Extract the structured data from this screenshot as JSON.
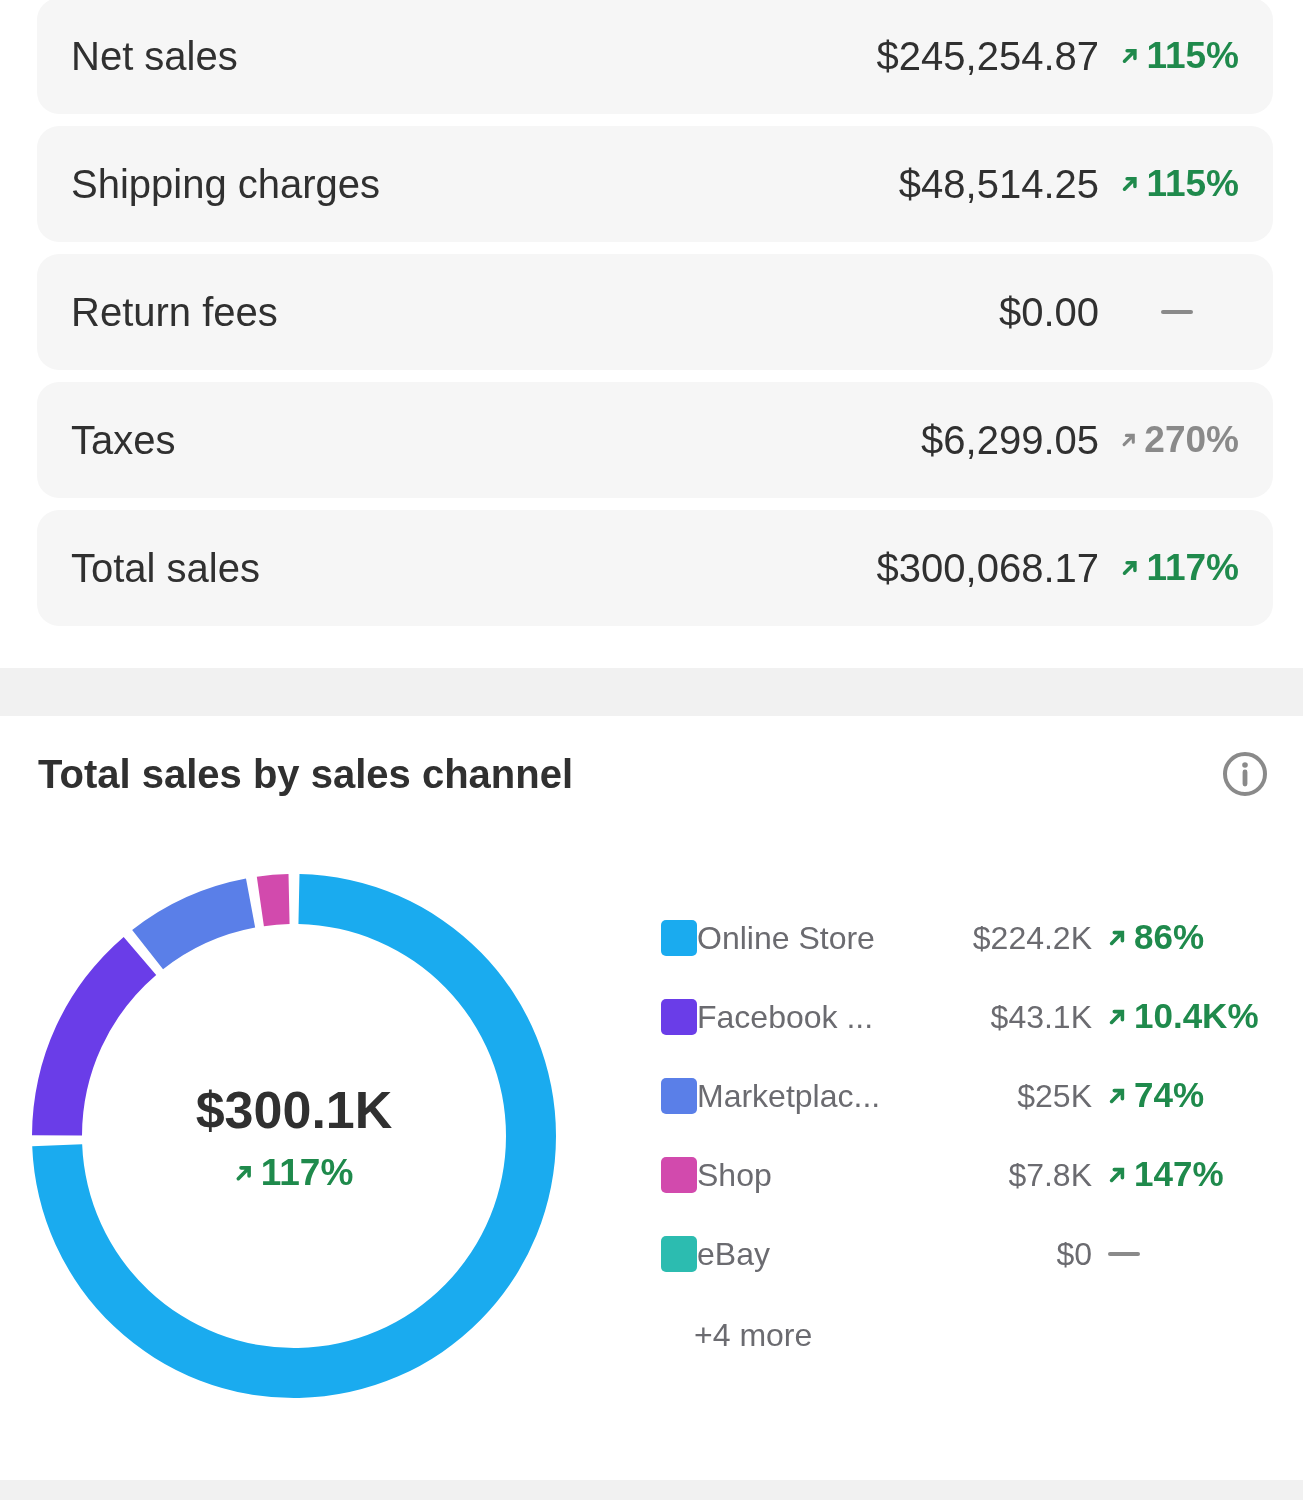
{
  "summary_rows": [
    {
      "label": "Net sales",
      "value": "$245,254.87",
      "trend": {
        "kind": "up",
        "text": "115%"
      }
    },
    {
      "label": "Shipping charges",
      "value": "$48,514.25",
      "trend": {
        "kind": "up",
        "text": "115%"
      }
    },
    {
      "label": "Return fees",
      "value": "$0.00",
      "trend": {
        "kind": "flat"
      }
    },
    {
      "label": "Taxes",
      "value": "$6,299.05",
      "trend": {
        "kind": "up_muted",
        "text": "270%"
      }
    },
    {
      "label": "Total sales",
      "value": "$300,068.17",
      "trend": {
        "kind": "up",
        "text": "117%"
      }
    }
  ],
  "channel_card": {
    "title": "Total sales by sales channel",
    "total": "$300.1K",
    "total_trend": {
      "kind": "up",
      "text": "117%"
    },
    "chart_data": {
      "type": "donut",
      "categories": [
        "Online Store",
        "Facebook ...",
        "Marketplac...",
        "Shop",
        "eBay"
      ],
      "values": [
        74.71,
        14.36,
        8.33,
        2.6,
        0
      ]
    },
    "legend": [
      {
        "color": "#1aabef",
        "value": "$224.2K",
        "trend": {
          "kind": "up",
          "text": "86%"
        }
      },
      {
        "color": "#6a3de8",
        "value": "$43.1K",
        "trend": {
          "kind": "up",
          "text": "10.4K%"
        }
      },
      {
        "color": "#5a7fe8",
        "value": "$25K",
        "trend": {
          "kind": "up",
          "text": "74%"
        }
      },
      {
        "color": "#d24aad",
        "value": "$7.8K",
        "trend": {
          "kind": "up",
          "text": "147%"
        }
      },
      {
        "color": "#2cbcb0",
        "value": "$0",
        "trend": {
          "kind": "flat"
        }
      }
    ],
    "more": "+4 more"
  }
}
